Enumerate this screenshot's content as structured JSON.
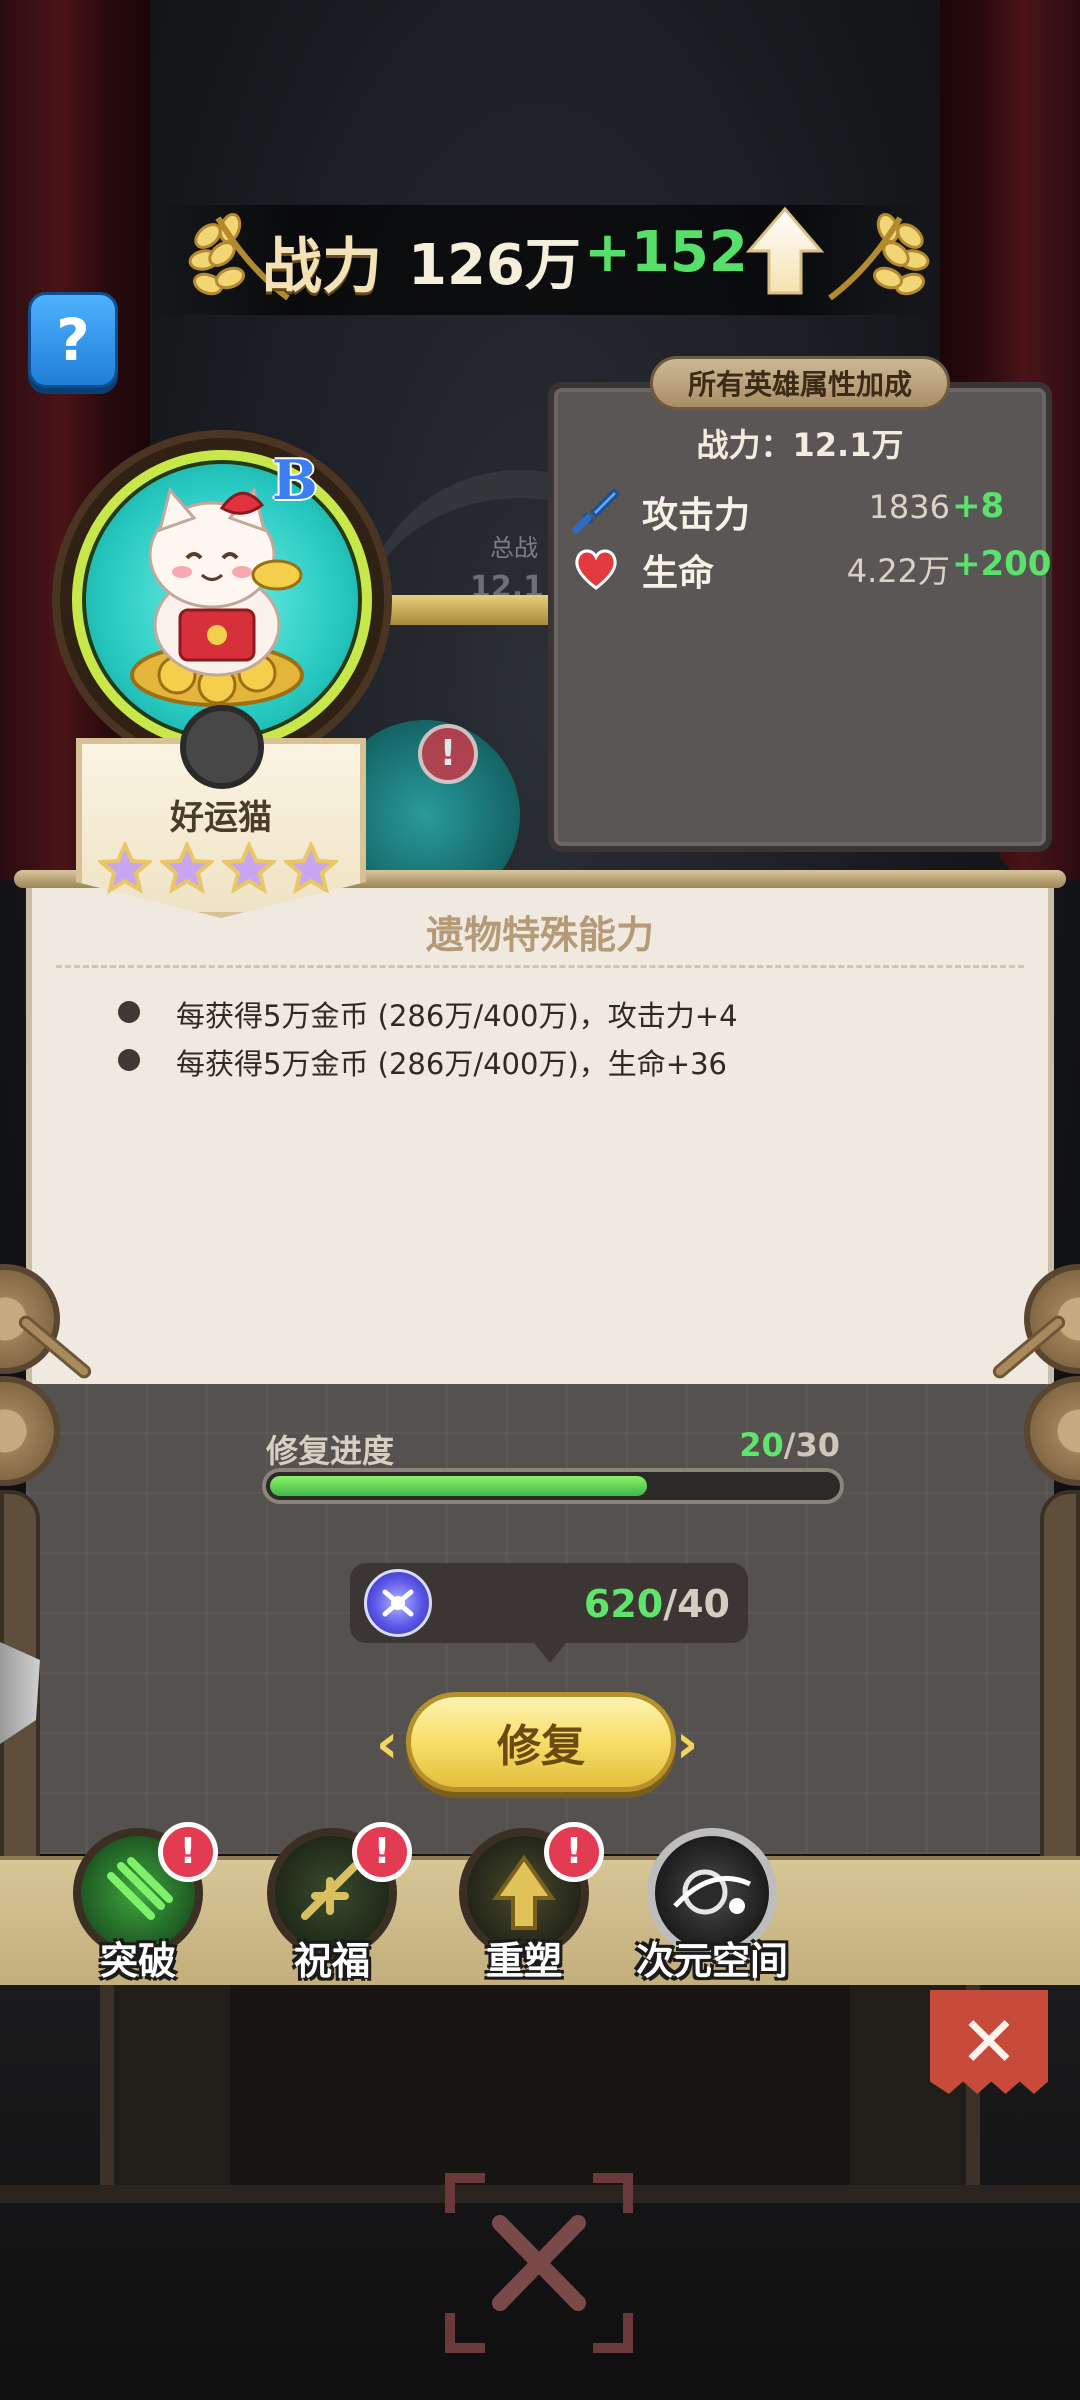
{
  "header": {
    "power_label": "战力",
    "power_value": "126万",
    "power_delta": "+152"
  },
  "help": {
    "label": "?"
  },
  "hero": {
    "name": "好运猫",
    "rarity": "B",
    "stars": 4
  },
  "stats_panel": {
    "title": "所有英雄属性加成",
    "power": "战力：12.1万",
    "rows": [
      {
        "icon": "sword-icon",
        "name": "攻击力",
        "value": "1836",
        "plus": "+8"
      },
      {
        "icon": "heart-icon",
        "name": "生命",
        "value": "4.22万",
        "plus": "+200"
      }
    ]
  },
  "background_text": {
    "total_power_label": "总战",
    "total_power_value": "12.1"
  },
  "relic": {
    "title": "遗物特殊能力",
    "lines": [
      "每获得5万金币 (286万/400万)，攻击力+4",
      "每获得5万金币 (286万/400万)，生命+36"
    ]
  },
  "repair": {
    "progress_label": "修复进度",
    "progress_current": "20",
    "progress_total": "/30",
    "progress_fraction": 0.6667,
    "cost_have": "620",
    "cost_need": "/40",
    "button_label": "修复",
    "prev": "‹",
    "next": "›"
  },
  "tabs": [
    {
      "label": "突破",
      "icon": "breakthrough-icon",
      "alert": "!"
    },
    {
      "label": "祝福",
      "icon": "blessing-icon",
      "alert": "!"
    },
    {
      "label": "重塑",
      "icon": "reshape-icon",
      "alert": "!"
    },
    {
      "label": "次元空间",
      "icon": "dimension-space-icon",
      "alert": ""
    }
  ],
  "close": {
    "label": "✕"
  },
  "colors": {
    "accent_green": "#59e36c",
    "gold": "#f7de6a",
    "alert_red": "#e23b52"
  }
}
